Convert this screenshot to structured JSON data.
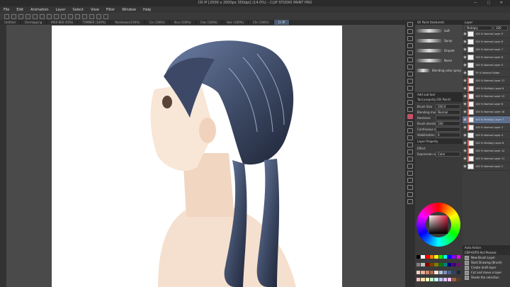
{
  "window": {
    "title": "CR IP [2000 x 2000px 350dpi] (14.0%) - CLIP STUDIO PAINT PRO",
    "controls": "— ▢ ✕"
  },
  "menu": [
    "File",
    "Edit",
    "Animation",
    "Layer",
    "Select",
    "View",
    "Filter",
    "Window",
    "Help"
  ],
  "tabs": [
    {
      "label": "Untitled",
      "active": false
    },
    {
      "label": "Overlapping",
      "active": false
    },
    {
      "label": "MAX 800 (50%)",
      "active": false
    },
    {
      "label": "TOMBER (100%)",
      "active": false
    },
    {
      "label": "Rambutan(100%)",
      "active": false
    },
    {
      "label": "Cin (100%)",
      "active": false
    },
    {
      "label": "Illus (100%)",
      "active": false
    },
    {
      "label": "Clas (100%)",
      "active": false
    },
    {
      "label": "Hair (100%)",
      "active": false
    },
    {
      "label": "Chr (100%)",
      "active": false
    },
    {
      "label": "Cr IP",
      "active": true
    }
  ],
  "brush_panel": {
    "header": "Oil Paint (textured)",
    "brushes": [
      "Soft",
      "Spray",
      "Droplet",
      "Noise",
      "Blending color spray"
    ],
    "add_label": "Add sub tool"
  },
  "tool_property": {
    "header": "Tool property [Oil Paint]",
    "rows": [
      {
        "label": "Brush Size",
        "value": "200.0"
      },
      {
        "label": "Blending mode",
        "value": "Normal"
      },
      {
        "label": "Hardness",
        "value": ""
      },
      {
        "label": "Brush density",
        "value": "100"
      },
      {
        "label": "Continuous spraying",
        "value": ""
      },
      {
        "label": "Stabilization",
        "value": "6"
      }
    ],
    "layer_property_header": "Layer Property",
    "effect_label": "Effect",
    "expression_label": "Expression color",
    "expression_value": "Color"
  },
  "layer_panel": {
    "header": "Layer",
    "blend_mode": "Multiply",
    "opacity": "100",
    "layers": [
      {
        "name": "100 % Normal Layer 9",
        "selected": false,
        "clip": false
      },
      {
        "name": "100 % Normal Layer 8",
        "selected": false,
        "clip": false
      },
      {
        "name": "100 % Normal Layer 7",
        "selected": false,
        "clip": false
      },
      {
        "name": "100 % Normal Layer 6",
        "selected": false,
        "clip": false
      },
      {
        "name": "100 % Normal Layer 5",
        "selected": false,
        "clip": false
      },
      {
        "name": "70 % Normal Folder",
        "selected": false,
        "clip": false
      },
      {
        "name": "100 % Normal Layer 17",
        "selected": false,
        "clip": true
      },
      {
        "name": "100 % Multiply Layer 6",
        "selected": false,
        "clip": true
      },
      {
        "name": "100 % Normal Layer 13",
        "selected": false,
        "clip": true
      },
      {
        "name": "100 % Normal Layer 8",
        "selected": false,
        "clip": true
      },
      {
        "name": "100 % Normal Layer 16",
        "selected": false,
        "clip": true
      },
      {
        "name": "100 % Multiply Layer 7",
        "selected": true,
        "clip": true
      },
      {
        "name": "100 % Normal Layer 3",
        "selected": false,
        "clip": true
      },
      {
        "name": "100 % Normal Layer 4",
        "selected": false,
        "clip": false
      },
      {
        "name": "100 % Multiply Layer 6",
        "selected": false,
        "clip": true
      },
      {
        "name": "100 % Normal Layer 12",
        "selected": false,
        "clip": true
      },
      {
        "name": "100 % Normal Layer 11",
        "selected": false,
        "clip": true
      },
      {
        "name": "100 % Normal Layer 2",
        "selected": false,
        "clip": false
      }
    ]
  },
  "auto_action": {
    "header": "Auto Action",
    "set": "CSP-AUTO-Act Process",
    "items": [
      "New Brush Layer",
      "Start Drawing (Brush)",
      "Create draft layer",
      "Cut and move a layer",
      "Shade the selection"
    ]
  },
  "palette": [
    "#000000",
    "#ffffff",
    "#ff0000",
    "#ff8000",
    "#ffff00",
    "#00ff00",
    "#00ffff",
    "#0000ff",
    "#8000ff",
    "#ff00ff",
    "#7f7f7f",
    "#c0c0c0",
    "#800000",
    "#804000",
    "#808000",
    "#008000",
    "#008080",
    "#000080",
    "#400080",
    "#800080",
    "#f6d0c0",
    "#e8b098",
    "#d08870",
    "#b06850",
    "#fce8d8",
    "#b0c0e0",
    "#8090b8",
    "#506088",
    "#304060",
    "#202838",
    "#ffc0c0",
    "#ffe0a0",
    "#ffffc0",
    "#c0ffc0",
    "#c0ffff",
    "#c0c0ff",
    "#e0c0ff",
    "#ffc0ff",
    "#a06040",
    "#604020"
  ],
  "colors": {
    "accent": "#5c6f8e",
    "clip_marker": "#d0625a",
    "hair": "#3a4660",
    "skin": "#f5e0cf"
  }
}
